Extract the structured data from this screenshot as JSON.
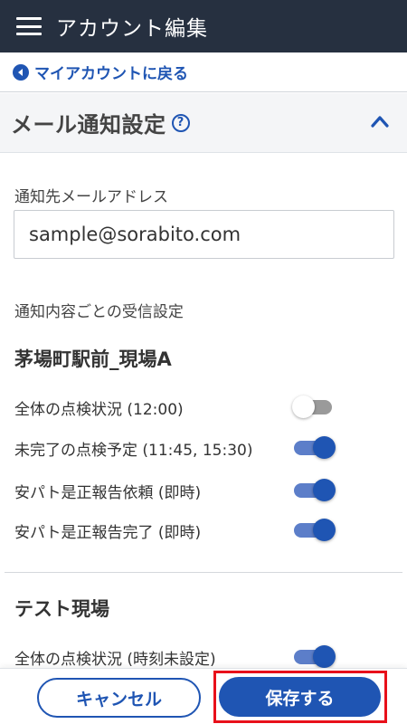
{
  "header": {
    "title": "アカウント編集",
    "menu_icon": "hamburger-menu-icon"
  },
  "back_link": {
    "label": "マイアカウントに戻る",
    "icon": "chevron-left-circle-icon"
  },
  "section": {
    "title": "メール通知設定",
    "help_icon": "question-circle-icon",
    "collapse_icon": "chevron-up-icon"
  },
  "email_field": {
    "label": "通知先メールアドレス",
    "value": "sample@sorabito.com"
  },
  "receive_settings_label": "通知内容ごとの受信設定",
  "sites": [
    {
      "name": "茅場町駅前_現場A",
      "items": [
        {
          "label": "全体の点検状況 (12:00)",
          "enabled": false
        },
        {
          "label": "未完了の点検予定 (11:45, 15:30)",
          "enabled": true
        },
        {
          "label": "安パト是正報告依頼 (即時)",
          "enabled": true
        },
        {
          "label": "安パト是正報告完了 (即時)",
          "enabled": true
        }
      ]
    },
    {
      "name": "テスト現場",
      "items": [
        {
          "label": "全体の点検状況 (時刻未設定)",
          "enabled": true
        }
      ]
    }
  ],
  "footer": {
    "cancel_label": "キャンセル",
    "save_label": "保存する"
  },
  "colors": {
    "header_bg": "#263040",
    "accent": "#1f55b3",
    "highlight": "#e8101a"
  }
}
